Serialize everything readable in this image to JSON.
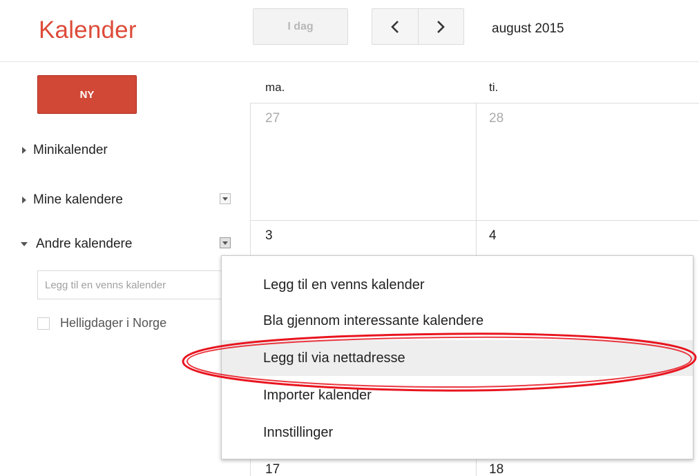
{
  "header": {
    "app_title": "Kalender",
    "today_label": "I dag",
    "prev_icon": "chevron-left-icon",
    "next_icon": "chevron-right-icon",
    "current_period": "august 2015"
  },
  "sidebar": {
    "new_button_label": "NY",
    "sections": [
      {
        "label": "Minikalender",
        "expanded": false
      },
      {
        "label": "Mine kalendere",
        "expanded": false
      },
      {
        "label": "Andre kalendere",
        "expanded": true
      }
    ],
    "friend_input_placeholder": "Legg til en venns kalender",
    "calendars": [
      {
        "label": "Helligdager i Norge",
        "checked": false
      }
    ]
  },
  "grid": {
    "day_headers": [
      "ma.",
      "ti."
    ],
    "week_rows": [
      {
        "dates": [
          "27",
          "28"
        ],
        "other_month": true
      },
      {
        "dates": [
          "3",
          "4"
        ],
        "other_month": false
      },
      {
        "dates": [
          "17",
          "18"
        ],
        "other_month": false
      }
    ]
  },
  "menu": {
    "items": [
      {
        "label": "Legg til en venns kalender"
      },
      {
        "label": "Bla gjennom interessante kalendere"
      },
      {
        "label": "Legg til via nettadresse",
        "highlighted": true
      },
      {
        "label": "Importer kalender"
      },
      {
        "label": "Innstillinger"
      }
    ]
  },
  "colors": {
    "brand_red": "#dd4b39",
    "new_button_red": "#d14836",
    "annotation_red": "#e8141e"
  }
}
